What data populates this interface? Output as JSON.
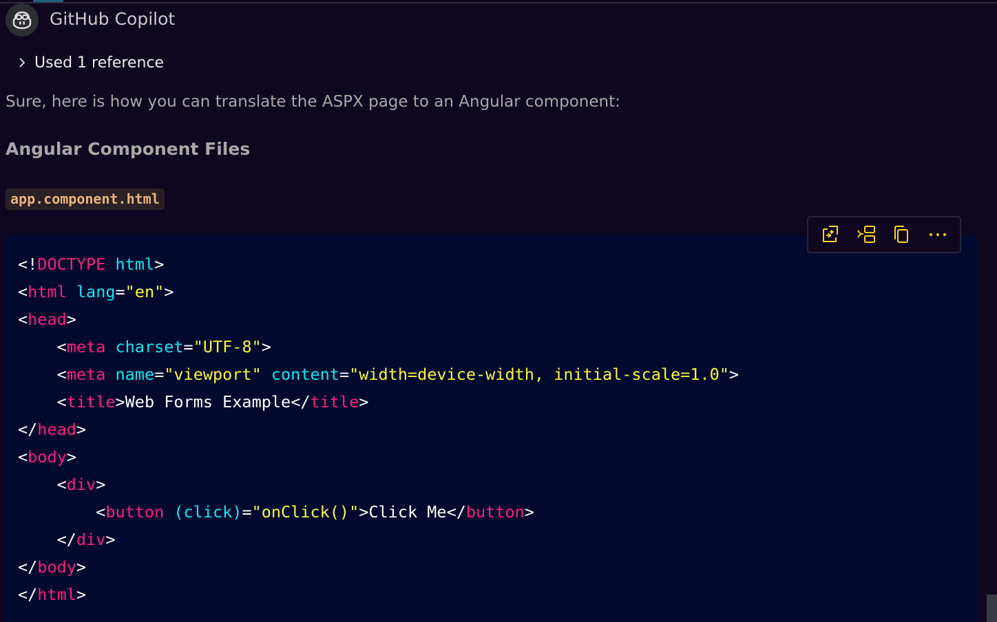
{
  "header": {
    "author": "GitHub Copilot",
    "avatar_icon": "copilot-icon"
  },
  "references": {
    "label": "Used 1 reference",
    "icon": "chevron-right-icon"
  },
  "message": {
    "intro": "Sure, here is how you can translate the ASPX page to an Angular component:",
    "heading": "Angular Component Files",
    "filename": "app.component.html"
  },
  "toolbar": {
    "buttons": [
      {
        "icon": "apply-in-editor-icon"
      },
      {
        "icon": "insert-at-cursor-icon"
      },
      {
        "icon": "copy-icon"
      },
      {
        "icon": "more-actions-icon"
      }
    ]
  },
  "colors": {
    "background": "#0f0620",
    "code_background": "#010a2e",
    "tag": "#ff1f7d",
    "attribute": "#18e6f0",
    "string": "#fff23a",
    "text": "#ffffff",
    "icon_accent": "#ffd21f",
    "filename": "#e8b37a"
  },
  "code_lines": [
    [
      {
        "t": "punc",
        "v": "<!"
      },
      {
        "t": "tag",
        "v": "DOCTYPE"
      },
      {
        "t": "punc",
        "v": " "
      },
      {
        "t": "attr",
        "v": "html"
      },
      {
        "t": "punc",
        "v": ">"
      }
    ],
    [
      {
        "t": "punc",
        "v": "<"
      },
      {
        "t": "tag",
        "v": "html"
      },
      {
        "t": "punc",
        "v": " "
      },
      {
        "t": "attr",
        "v": "lang"
      },
      {
        "t": "punc",
        "v": "="
      },
      {
        "t": "str",
        "v": "\"en\""
      },
      {
        "t": "punc",
        "v": ">"
      }
    ],
    [
      {
        "t": "punc",
        "v": "<"
      },
      {
        "t": "tag",
        "v": "head"
      },
      {
        "t": "punc",
        "v": ">"
      }
    ],
    [
      {
        "t": "punc",
        "v": "    <"
      },
      {
        "t": "tag",
        "v": "meta"
      },
      {
        "t": "punc",
        "v": " "
      },
      {
        "t": "attr",
        "v": "charset"
      },
      {
        "t": "punc",
        "v": "="
      },
      {
        "t": "str",
        "v": "\"UTF-8\""
      },
      {
        "t": "punc",
        "v": ">"
      }
    ],
    [
      {
        "t": "punc",
        "v": "    <"
      },
      {
        "t": "tag",
        "v": "meta"
      },
      {
        "t": "punc",
        "v": " "
      },
      {
        "t": "attr",
        "v": "name"
      },
      {
        "t": "punc",
        "v": "="
      },
      {
        "t": "str",
        "v": "\"viewport\""
      },
      {
        "t": "punc",
        "v": " "
      },
      {
        "t": "attr",
        "v": "content"
      },
      {
        "t": "punc",
        "v": "="
      },
      {
        "t": "str",
        "v": "\"width=device-width, initial-scale=1.0\""
      },
      {
        "t": "punc",
        "v": ">"
      }
    ],
    [
      {
        "t": "punc",
        "v": "    <"
      },
      {
        "t": "tag",
        "v": "title"
      },
      {
        "t": "punc",
        "v": ">"
      },
      {
        "t": "text",
        "v": "Web Forms Example"
      },
      {
        "t": "punc",
        "v": "</"
      },
      {
        "t": "tag",
        "v": "title"
      },
      {
        "t": "punc",
        "v": ">"
      }
    ],
    [
      {
        "t": "punc",
        "v": "</"
      },
      {
        "t": "tag",
        "v": "head"
      },
      {
        "t": "punc",
        "v": ">"
      }
    ],
    [
      {
        "t": "punc",
        "v": "<"
      },
      {
        "t": "tag",
        "v": "body"
      },
      {
        "t": "punc",
        "v": ">"
      }
    ],
    [
      {
        "t": "punc",
        "v": "    <"
      },
      {
        "t": "tag",
        "v": "div"
      },
      {
        "t": "punc",
        "v": ">"
      }
    ],
    [
      {
        "t": "punc",
        "v": "        <"
      },
      {
        "t": "tag",
        "v": "button"
      },
      {
        "t": "punc",
        "v": " "
      },
      {
        "t": "attr",
        "v": "(click)"
      },
      {
        "t": "punc",
        "v": "="
      },
      {
        "t": "str",
        "v": "\"onClick()\""
      },
      {
        "t": "punc",
        "v": ">"
      },
      {
        "t": "text",
        "v": "Click Me"
      },
      {
        "t": "punc",
        "v": "</"
      },
      {
        "t": "tag",
        "v": "button"
      },
      {
        "t": "punc",
        "v": ">"
      }
    ],
    [
      {
        "t": "punc",
        "v": "    </"
      },
      {
        "t": "tag",
        "v": "div"
      },
      {
        "t": "punc",
        "v": ">"
      }
    ],
    [
      {
        "t": "punc",
        "v": "</"
      },
      {
        "t": "tag",
        "v": "body"
      },
      {
        "t": "punc",
        "v": ">"
      }
    ],
    [
      {
        "t": "punc",
        "v": "</"
      },
      {
        "t": "tag",
        "v": "html"
      },
      {
        "t": "punc",
        "v": ">"
      }
    ]
  ]
}
